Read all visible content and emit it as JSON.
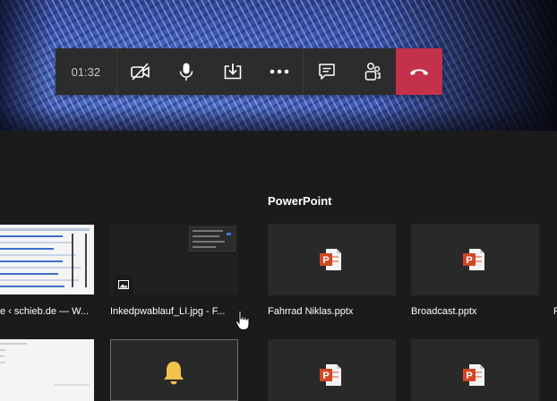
{
  "call": {
    "timer": "01:32",
    "controls": [
      {
        "name": "camera-off-button",
        "icon": "video-off-icon"
      },
      {
        "name": "microphone-button",
        "icon": "microphone-icon"
      },
      {
        "name": "share-tray-button",
        "icon": "share-icon"
      },
      {
        "name": "more-actions-button",
        "icon": "more-icon"
      },
      {
        "name": "chat-button",
        "icon": "chat-icon"
      },
      {
        "name": "participants-button",
        "icon": "people-icon"
      },
      {
        "name": "hang-up-button",
        "icon": "phone-hangup-icon"
      }
    ],
    "hangup_color": "#c4314b"
  },
  "share": {
    "powerpoint_title": "PowerPoint",
    "windows": [
      {
        "label": "e ‹ schieb.de — W..."
      },
      {
        "label": "Inkedpwablauf_LI.jpg - F..."
      }
    ],
    "files": [
      {
        "label": "Fahrrad Niklas.pptx"
      },
      {
        "label": "Broadcast.pptx"
      },
      {
        "label": "P"
      }
    ]
  }
}
